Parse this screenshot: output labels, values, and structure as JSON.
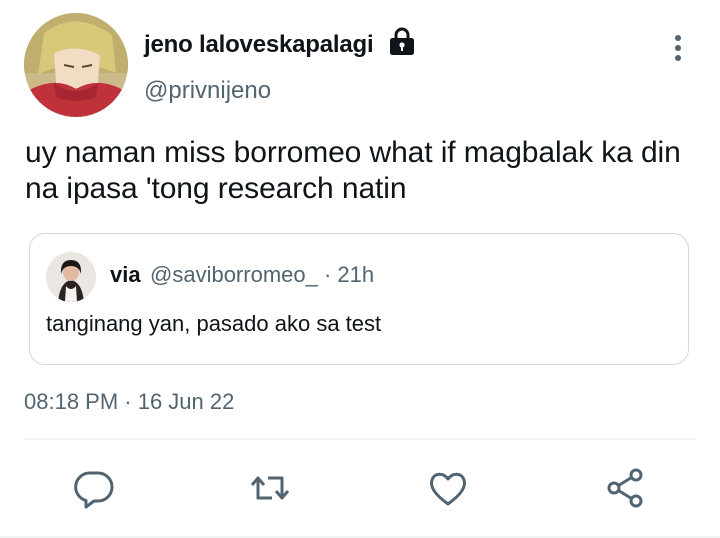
{
  "author": {
    "display_name": "jeno laloveskapalagi",
    "handle": "@privnijeno",
    "protected_icon": "lock-icon"
  },
  "tweet": {
    "text": "uy naman miss borromeo what if magbalak ka din na ipasa 'tong research natin",
    "timestamp": "08:18 PM · 16 Jun 22"
  },
  "quoted_tweet": {
    "display_name": "via",
    "handle_time": "@saviborromeo_ · 21h",
    "text": "tanginang yan, pasado ako sa test"
  },
  "actions": {
    "reply_icon": "reply-icon",
    "retweet_icon": "retweet-icon",
    "like_icon": "heart-icon",
    "share_icon": "share-icon",
    "more_icon": "more-vertical-icon"
  },
  "colors": {
    "text_primary": "#0f1419",
    "text_secondary": "#536471",
    "border": "#cfd9de",
    "icon": "#536471"
  }
}
